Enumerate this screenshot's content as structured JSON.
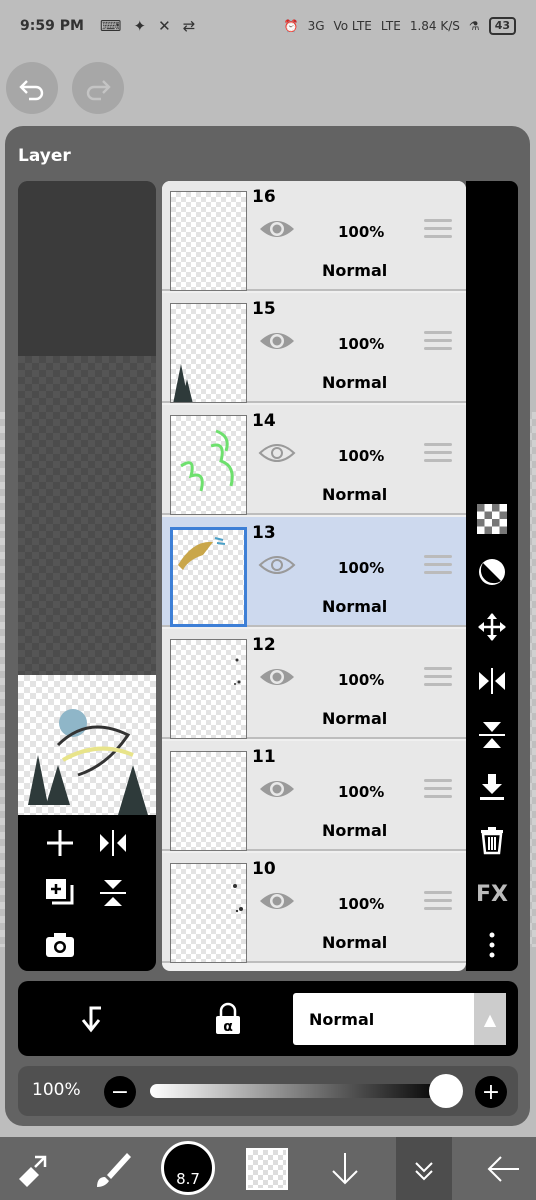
{
  "status_bar": {
    "time": "9:59 PM",
    "net_3g": "3G",
    "volte": "Vo LTE",
    "lte": "LTE",
    "speed": "1.84",
    "speed_unit": "K/S",
    "battery": "43"
  },
  "dialog": {
    "title": "Layer"
  },
  "layers": [
    {
      "number": "16",
      "opacity": "100%",
      "blend": "Normal",
      "visible": true,
      "selected": false
    },
    {
      "number": "15",
      "opacity": "100%",
      "blend": "Normal",
      "visible": true,
      "selected": false
    },
    {
      "number": "14",
      "opacity": "100%",
      "blend": "Normal",
      "visible": false,
      "selected": false
    },
    {
      "number": "13",
      "opacity": "100%",
      "blend": "Normal",
      "visible": false,
      "selected": true
    },
    {
      "number": "12",
      "opacity": "100%",
      "blend": "Normal",
      "visible": true,
      "selected": false
    },
    {
      "number": "11",
      "opacity": "100%",
      "blend": "Normal",
      "visible": true,
      "selected": false
    },
    {
      "number": "10",
      "opacity": "100%",
      "blend": "Normal",
      "visible": true,
      "selected": false
    }
  ],
  "right_toolbar": {
    "fx_label": "FX"
  },
  "bottom_bar": {
    "blend_mode": "Normal",
    "alpha_lock": "α"
  },
  "opacity_bar": {
    "label": "100%",
    "value": 1.0
  },
  "app_bar": {
    "brush_size": "8.7"
  },
  "colors": {
    "selected_row": "#cdd9ee",
    "selected_border": "#3d7fd6"
  }
}
